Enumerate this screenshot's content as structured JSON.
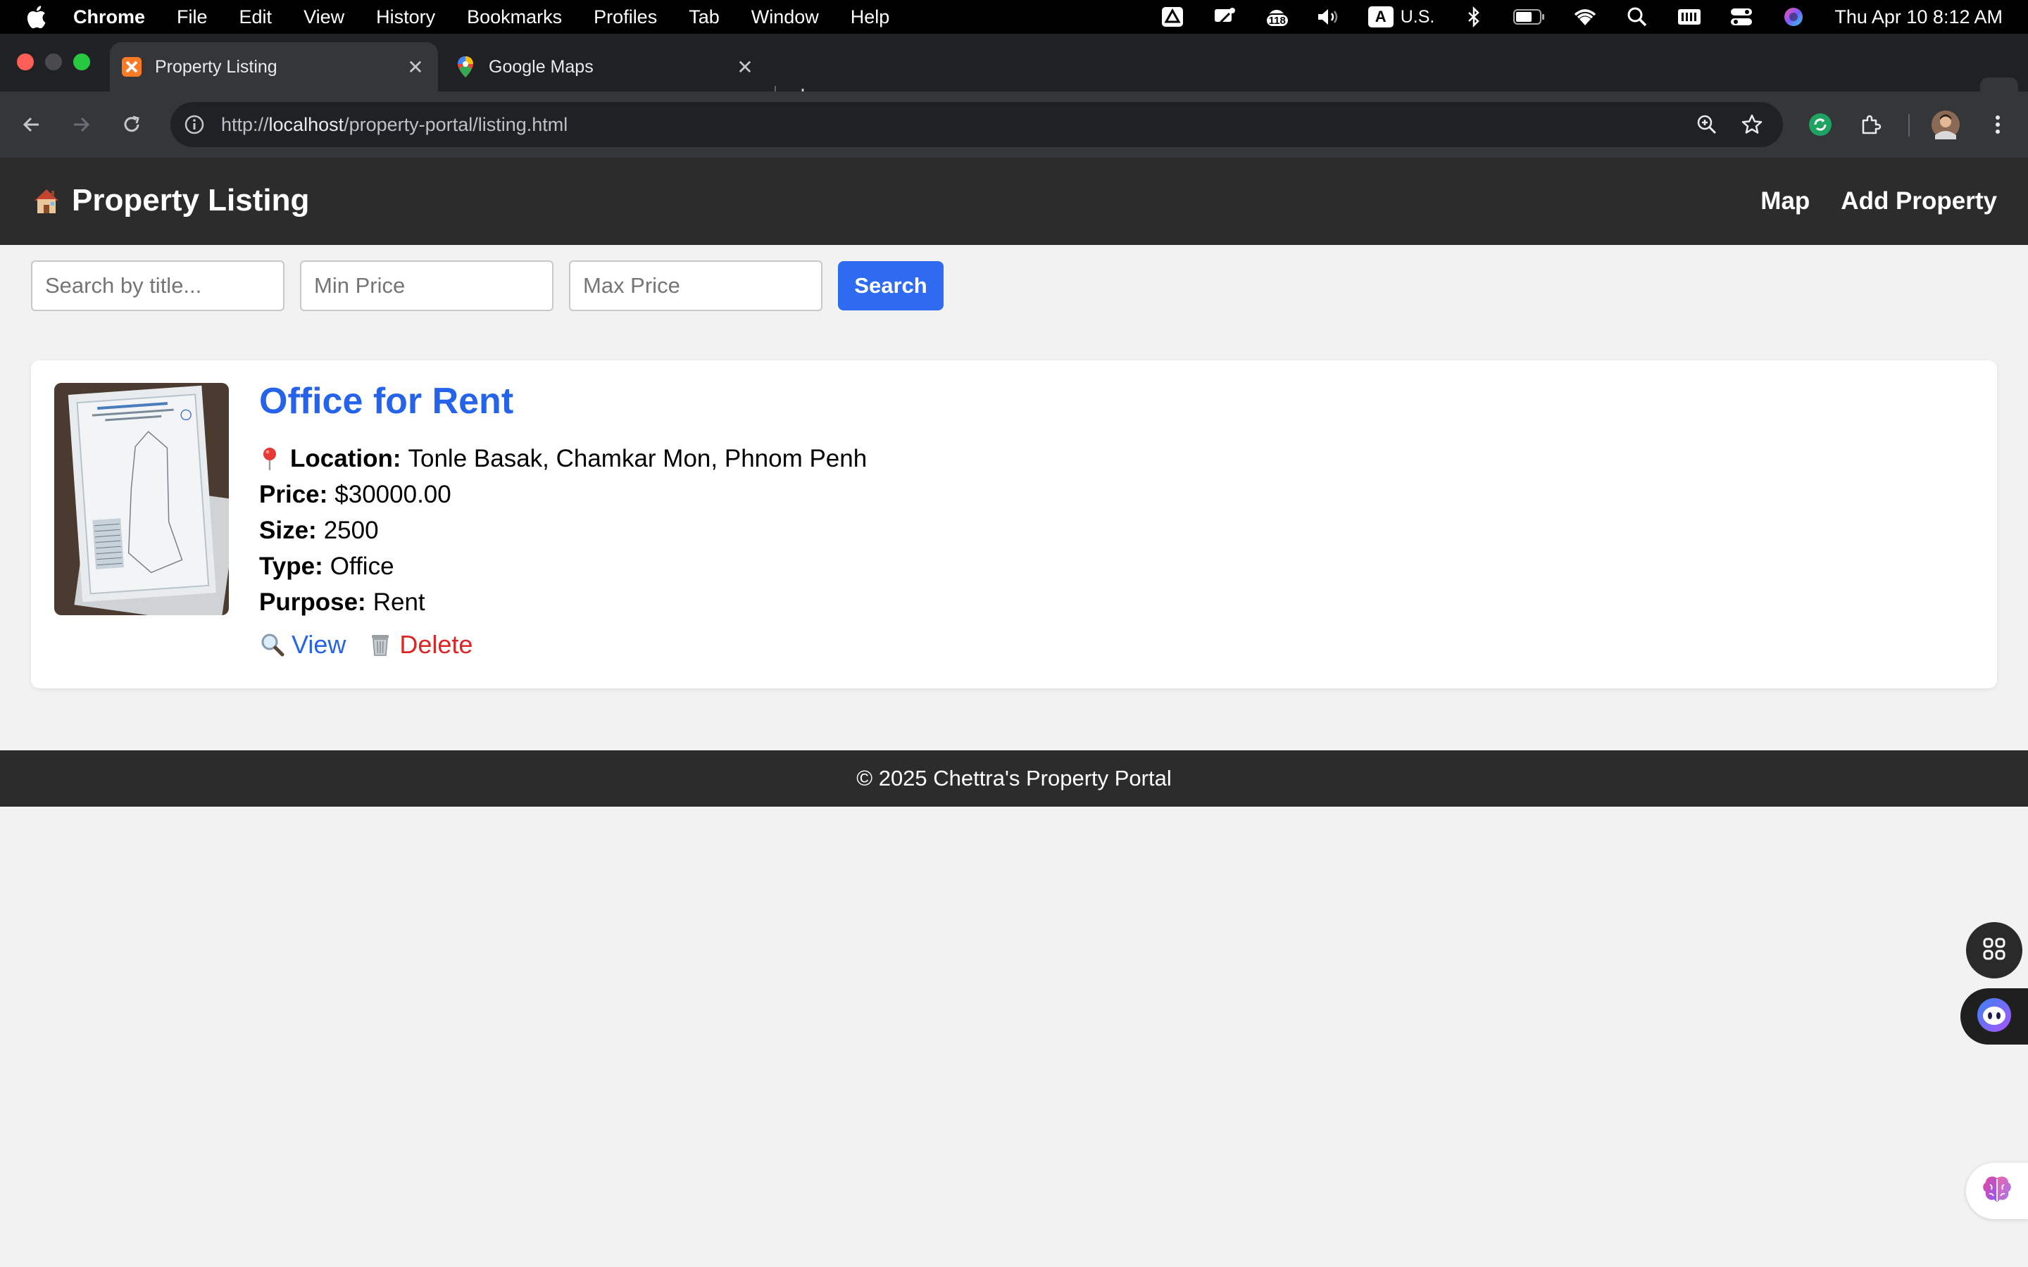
{
  "menubar": {
    "app_name": "Chrome",
    "items": [
      "File",
      "Edit",
      "View",
      "History",
      "Bookmarks",
      "Profiles",
      "Tab",
      "Window",
      "Help"
    ],
    "notification_count": "118",
    "keyboard_badge": "A",
    "input_source": "U.S.",
    "clock": "Thu Apr 10  8:12 AM"
  },
  "browser": {
    "tabs": [
      {
        "title": "Property Listing",
        "active": true,
        "icon": "xampp-icon"
      },
      {
        "title": "Google Maps",
        "active": false,
        "icon": "google-maps-icon"
      }
    ],
    "new_tab_symbol": "+",
    "close_symbol": "✕",
    "url_prefix": "http://",
    "url_host": "localhost",
    "url_path": "/property-portal/listing.html"
  },
  "site": {
    "brand_icon": "house-emoji",
    "brand": "Property Listing",
    "nav": [
      "Map",
      "Add Property"
    ]
  },
  "search": {
    "title_placeholder": "Search by title...",
    "min_placeholder": "Min Price",
    "max_placeholder": "Max Price",
    "button_label": "Search"
  },
  "listings": [
    {
      "title": "Office for Rent",
      "location_label": "Location:",
      "location": "Tonle Basak, Chamkar Mon, Phnom Penh",
      "price_label": "Price:",
      "price": "$30000.00",
      "size_label": "Size:",
      "size": "2500",
      "type_label": "Type:",
      "type": "Office",
      "purpose_label": "Purpose:",
      "purpose": "Rent",
      "view_label": "View",
      "delete_label": "Delete"
    }
  ],
  "footer": {
    "text": "© 2025 Chettra's Property Portal"
  },
  "colors": {
    "link_blue": "#2563eb",
    "delete_red": "#dc2626",
    "header_bg": "#2c2c2c",
    "search_button": "#2e6bf0",
    "page_bg": "#f2f2f2"
  }
}
